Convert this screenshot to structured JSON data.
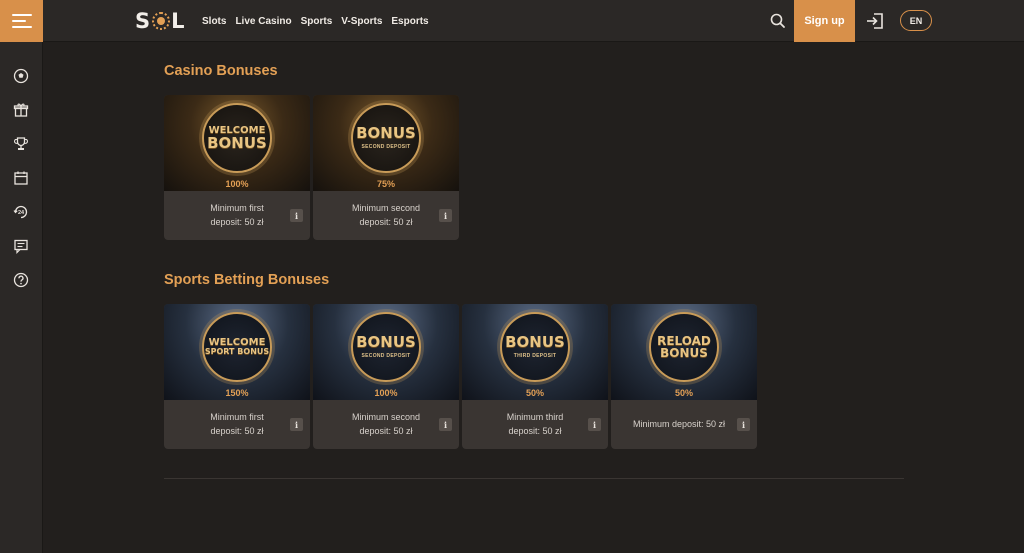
{
  "header": {
    "logo_left": "S",
    "logo_right": "L",
    "nav": [
      "Slots",
      "Live Casino",
      "Sports",
      "V-Sports",
      "Esports"
    ],
    "signup_label": "Sign up",
    "lang": "EN"
  },
  "sidebar": {
    "icons": [
      "football-icon",
      "gift-icon",
      "trophy-icon",
      "calendar-icon",
      "support-24-icon",
      "chat-icon",
      "help-icon"
    ],
    "support_label": "24"
  },
  "casino": {
    "title": "Casino Bonuses",
    "cards": [
      {
        "emblem_main_1": "WELCOME",
        "emblem_main_2": "BONUS",
        "emblem_sub": "",
        "percent": "100%",
        "desc_1": "Minimum first",
        "desc_2": "deposit: 50 zł"
      },
      {
        "emblem_main_1": "BONUS",
        "emblem_main_2": "",
        "emblem_sub": "SECOND DEPOSIT",
        "percent": "75%",
        "desc_1": "Minimum second",
        "desc_2": "deposit: 50 zł"
      }
    ]
  },
  "sports": {
    "title": "Sports Betting Bonuses",
    "cards": [
      {
        "emblem_main_1": "WELCOME",
        "emblem_main_2": "SPORT BONUS",
        "emblem_sub": "",
        "percent": "150%",
        "desc_1": "Minimum first",
        "desc_2": "deposit: 50 zł"
      },
      {
        "emblem_main_1": "BONUS",
        "emblem_main_2": "",
        "emblem_sub": "SECOND DEPOSIT",
        "percent": "100%",
        "desc_1": "Minimum second",
        "desc_2": "deposit: 50 zł"
      },
      {
        "emblem_main_1": "BONUS",
        "emblem_main_2": "",
        "emblem_sub": "THIRD DEPOSIT",
        "percent": "50%",
        "desc_1": "Minimum third",
        "desc_2": "deposit: 50 zł"
      },
      {
        "emblem_main_1": "RELOAD",
        "emblem_main_2": "BONUS",
        "emblem_sub": "",
        "percent": "50%",
        "desc_1": "Minimum deposit: 50 zł",
        "desc_2": ""
      }
    ]
  },
  "info_label": "i",
  "colors": {
    "accent": "#d8904a",
    "title": "#e3a055",
    "background": "#221f1d",
    "card": "#3a3532"
  }
}
